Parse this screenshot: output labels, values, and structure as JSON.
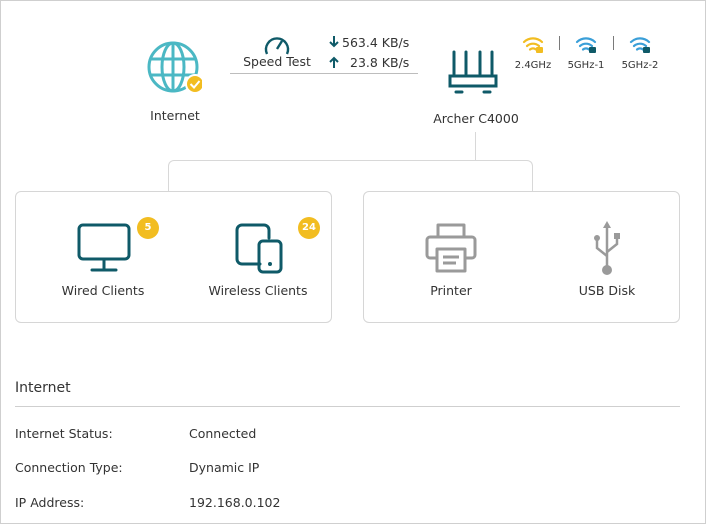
{
  "internet": {
    "label": "Internet"
  },
  "speed_test": {
    "label": "Speed Test",
    "download": "563.4 KB/s",
    "upload": "23.8 KB/s"
  },
  "router": {
    "name": "Archer C4000"
  },
  "bands": [
    {
      "label": "2.4GHz",
      "color": "#f2bd21"
    },
    {
      "label": "5GHz-1",
      "color": "#3a9fd8"
    },
    {
      "label": "5GHz-2",
      "color": "#3a9fd8"
    }
  ],
  "clients": {
    "wired": {
      "label": "Wired Clients",
      "count": "5"
    },
    "wireless": {
      "label": "Wireless Clients",
      "count": "24"
    }
  },
  "devices": {
    "printer": {
      "label": "Printer"
    },
    "usb": {
      "label": "USB Disk"
    }
  },
  "info": {
    "title": "Internet",
    "rows": [
      {
        "label": "Internet Status:",
        "value": "Connected"
      },
      {
        "label": "Connection Type:",
        "value": "Dynamic IP"
      },
      {
        "label": "IP Address:",
        "value": "192.168.0.102"
      }
    ]
  },
  "colors": {
    "teal": "#0f5a68",
    "globe": "#4bb8c4",
    "badge": "#f2bd21",
    "grey": "#9a9a9a"
  }
}
